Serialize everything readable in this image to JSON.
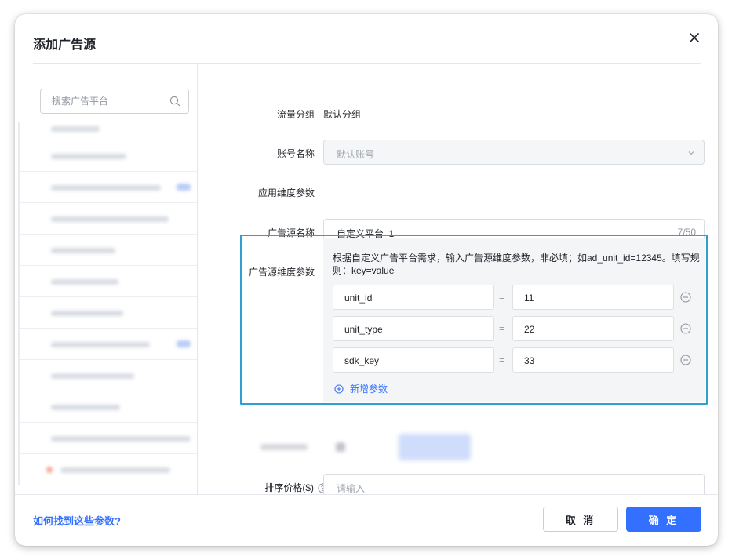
{
  "dialog": {
    "title": "添加广告源",
    "help_link": "如何找到这些参数?",
    "cancel_label": "取 消",
    "confirm_label": "确 定"
  },
  "sidebar": {
    "search_placeholder": "搜索广告平台"
  },
  "form": {
    "traffic_group": {
      "label": "流量分组",
      "value": "默认分组"
    },
    "account_name": {
      "label": "账号名称",
      "placeholder": "默认账号"
    },
    "app_params": {
      "label": "应用维度参数"
    },
    "ad_source_name": {
      "label": "广告源名称",
      "value": "自定义平台_1",
      "count": "7/50"
    },
    "ad_source_params": {
      "label": "广告源维度参数",
      "hint": "根据自定义广告平台需求，输入广告源维度参数，非必填；如ad_unit_id=12345。填写规则：key=value",
      "rows": [
        {
          "key": "unit_id",
          "eq": "=",
          "value": "11"
        },
        {
          "key": "unit_type",
          "eq": "=",
          "value": "22"
        },
        {
          "key": "sdk_key",
          "eq": "=",
          "value": "33"
        }
      ],
      "add_label": "新增参数"
    },
    "sort_price": {
      "label": "排序价格($)",
      "placeholder": "请输入"
    }
  }
}
